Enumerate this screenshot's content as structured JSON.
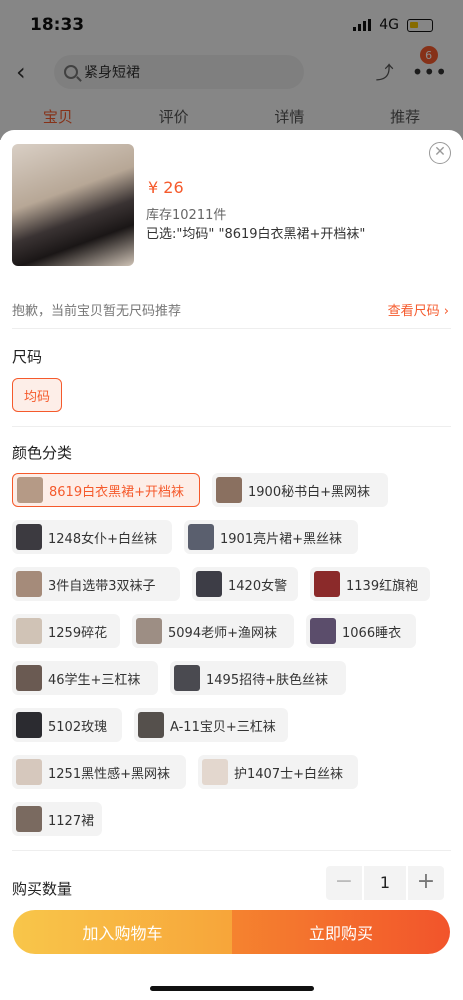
{
  "status": {
    "time": "18:33",
    "network": "4G"
  },
  "nav": {
    "search_text": "紧身短裙",
    "cart_count": "6"
  },
  "tabs": [
    {
      "label": "宝贝"
    },
    {
      "label": "评价"
    },
    {
      "label": "详情"
    },
    {
      "label": "推荐"
    }
  ],
  "product": {
    "price": "¥ 26",
    "stock": "库存10211件",
    "selected": "已选:\"均码\" \"8619白衣黑裙+开档袜\""
  },
  "notice": {
    "text": "抱歉，当前宝贝暂无尺码推荐",
    "link": "查看尺码 ›"
  },
  "size": {
    "title": "尺码",
    "options": [
      "均码"
    ]
  },
  "color": {
    "title": "颜色分类",
    "options": [
      "8619白衣黑裙+开档袜",
      "1900秘书白+黑网袜",
      "1248女仆+白丝袜",
      "1901亮片裙+黑丝袜",
      "3件自选带3双袜子",
      "1420女警",
      "1139红旗袍",
      "1259碎花",
      "5094老师+渔网袜",
      "1066睡衣",
      "46学生+三杠袜",
      "1495招待+肤色丝袜",
      "5102玫瑰",
      "A-11宝贝+三杠袜",
      "1251黑性感+黑网袜",
      "护1407士+白丝袜",
      "1127裙"
    ]
  },
  "quantity": {
    "label": "购买数量",
    "value": "1",
    "minus": "−",
    "plus": "+"
  },
  "actions": {
    "add_to_cart": "加入购物车",
    "buy_now": "立即购买"
  },
  "colors": {
    "accent": "#f55a2c"
  }
}
